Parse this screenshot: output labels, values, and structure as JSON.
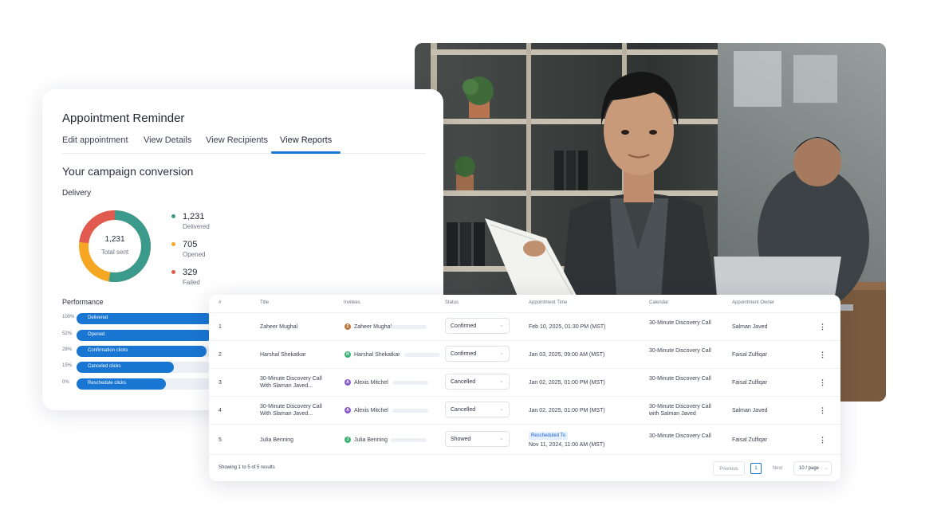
{
  "campaign": {
    "title": "Appointment Reminder",
    "tabs": [
      "Edit appointment",
      "View Details",
      "View Recipients",
      "View Reports"
    ],
    "active_tab": "View Reports",
    "conversion_title": "Your campaign conversion",
    "delivery": {
      "label": "Delivery",
      "total": "1,231",
      "total_label": "Total sent",
      "legend": [
        {
          "value": "1,231",
          "label": "Delivered",
          "color": "#3a9a8c"
        },
        {
          "value": "705",
          "label": "Opened",
          "color": "#f5a623"
        },
        {
          "value": "329",
          "label": "Failed",
          "color": "#e05a4f"
        }
      ]
    },
    "performance": {
      "label": "Performance",
      "rows": [
        {
          "pct": "100%",
          "label": "Delivered",
          "fraction": 1.0
        },
        {
          "pct": "52%",
          "label": "Opened",
          "fraction": 1.0
        },
        {
          "pct": "28%",
          "label": "Confirmation clicks",
          "fraction": 0.96
        },
        {
          "pct": "15%",
          "label": "Canceled clicks",
          "fraction": 0.72
        },
        {
          "pct": "0%",
          "label": "Reschedule clicks",
          "fraction": 0.66
        }
      ]
    }
  },
  "table": {
    "headers": [
      "#",
      "Title",
      "Invitees",
      "Status",
      "Appointment Time",
      "Calendar",
      "Appointment Owner"
    ],
    "rows": [
      {
        "num": "1",
        "title": "Zaheer Mughal",
        "invitee": "Zaheer Mughal",
        "initial": "Z",
        "avatar_color": "#c0773d",
        "status": "Confirmed",
        "badge": "",
        "time": "Feb 10, 2025, 01:30 PM (MST)",
        "calendar": "30-Minute Discovery Call",
        "owner": "Salman Javed"
      },
      {
        "num": "2",
        "title": "Harshal Shekatkar",
        "invitee": "Harshal Shekatkar",
        "initial": "H",
        "avatar_color": "#3bb273",
        "status": "Confirmed",
        "badge": "",
        "time": "Jan 03, 2025, 09:00 AM (MST)",
        "calendar": "30-Minute Discovery Call",
        "owner": "Faisal Zulfiqar"
      },
      {
        "num": "3",
        "title": "30-Minute Discovery Call With Slaman Javed...",
        "invitee": "Alexis Mitchel",
        "initial": "A",
        "avatar_color": "#8b5cc9",
        "status": "Cancelled",
        "badge": "",
        "time": "Jan 02, 2025, 01:00 PM (MST)",
        "calendar": "30-Minute Discovery Call",
        "owner": "Faisal Zulfiqar"
      },
      {
        "num": "4",
        "title": "30-Minute Discovery Call With Slaman Javed...",
        "invitee": "Alexis Mitchel",
        "initial": "A",
        "avatar_color": "#8b5cc9",
        "status": "Cancelled",
        "badge": "",
        "time": "Jan 02, 2025, 01:00 PM (MST)",
        "calendar": "30-Minute Discovery Call with Salman Javed",
        "owner": "Salman Javed"
      },
      {
        "num": "5",
        "title": "Julia Benning",
        "invitee": "Julia Benning",
        "initial": "J",
        "avatar_color": "#3bb273",
        "status": "Showed",
        "badge": "Rescheduled To",
        "time": "Nov 11, 2024, 11:00 AM (MST)",
        "calendar": "30-Minute Discovery Call",
        "owner": "Faisal Zulfiqar"
      }
    ],
    "footer_text": "Showing 1 to 5 of 5 results",
    "pagination": {
      "previous": "Previous",
      "page": "1",
      "next": "Next",
      "per_page": "10 / page"
    }
  },
  "icons": {
    "status_chevron": "chevron-down-icon",
    "row_menu": "kebab-menu-icon"
  },
  "colors": {
    "accent": "#1976d2",
    "delivered": "#3a9a8c",
    "opened": "#f5a623",
    "failed": "#e05a4f"
  }
}
